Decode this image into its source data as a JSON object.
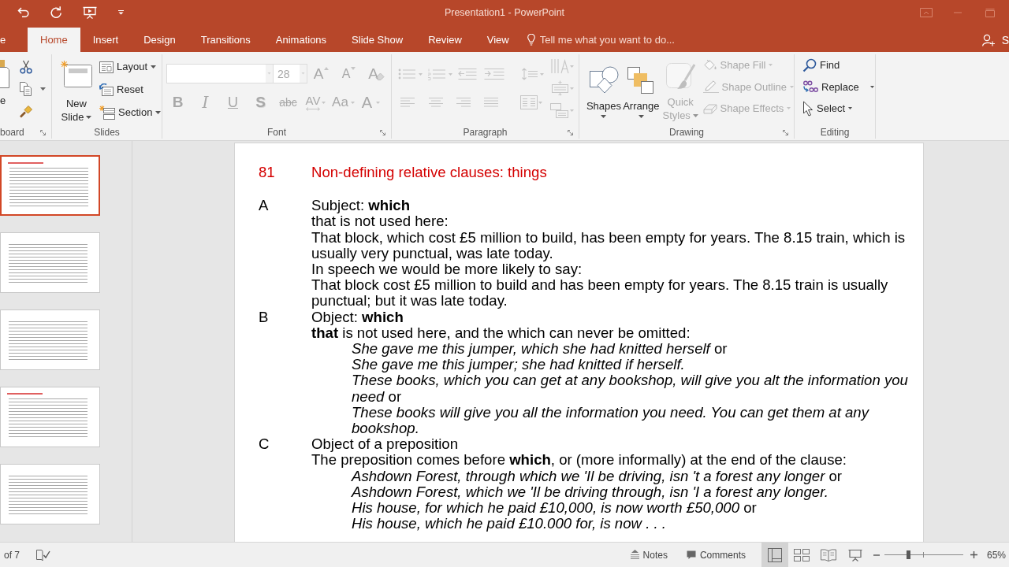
{
  "title_bar": {
    "title": "Presentation1 - PowerPoint"
  },
  "tabs": [
    {
      "label": "e",
      "selected": false
    },
    {
      "label": "Home",
      "selected": true
    },
    {
      "label": "Insert",
      "selected": false
    },
    {
      "label": "Design",
      "selected": false
    },
    {
      "label": "Transitions",
      "selected": false
    },
    {
      "label": "Animations",
      "selected": false
    },
    {
      "label": "Slide Show",
      "selected": false
    },
    {
      "label": "Review",
      "selected": false
    },
    {
      "label": "View",
      "selected": false
    }
  ],
  "tell_me": {
    "placeholder": "Tell me what you want to do..."
  },
  "account": {
    "label": "S"
  },
  "ribbon": {
    "groups": [
      {
        "label": "board",
        "controls": [
          {
            "label": "e",
            "disabled": false
          },
          {
            "disabled": false
          },
          {
            "disabled": false
          },
          {
            "disabled": false
          }
        ]
      },
      {
        "label": "Slides",
        "controls": [
          {
            "label": "New Slide",
            "disabled": false
          },
          {
            "label": "Layout",
            "disabled": false
          },
          {
            "label": "Reset",
            "disabled": false
          },
          {
            "label": "Section",
            "disabled": false
          }
        ]
      },
      {
        "label": "Font",
        "controls": [
          {
            "disabled": true
          },
          {
            "value": "28",
            "disabled": true
          },
          {
            "label": "A",
            "disabled": true
          },
          {
            "label": "A",
            "disabled": true
          },
          {
            "label": "A",
            "disabled": true
          },
          {
            "label": "B",
            "disabled": true
          },
          {
            "label": "I",
            "disabled": true
          },
          {
            "label": "U",
            "disabled": true
          },
          {
            "label": "S",
            "disabled": true
          },
          {
            "label": "abc",
            "disabled": true
          },
          {
            "label": "AV",
            "disabled": true
          },
          {
            "label": "Aa",
            "disabled": true
          },
          {
            "label": "A",
            "disabled": true
          }
        ]
      },
      {
        "label": "Paragraph",
        "controls": [
          {
            "disabled": true
          },
          {
            "disabled": true
          },
          {
            "disabled": true
          },
          {
            "disabled": true
          },
          {
            "disabled": true
          },
          {
            "disabled": true
          },
          {
            "disabled": true
          },
          {
            "disabled": true
          },
          {
            "disabled": true
          },
          {
            "disabled": true
          },
          {
            "disabled": true
          },
          {
            "disabled": true
          },
          {
            "disabled": true
          }
        ]
      },
      {
        "label": "Drawing",
        "controls": [
          {
            "label": "Shapes",
            "disabled": false
          },
          {
            "label": "Arrange",
            "disabled": false
          },
          {
            "label": "Quick Styles",
            "disabled": true
          },
          {
            "label": "Shape Fill",
            "disabled": true
          },
          {
            "label": "Shape Outline",
            "disabled": true
          },
          {
            "label": "Shape Effects",
            "disabled": true
          }
        ]
      },
      {
        "label": "Editing",
        "controls": [
          {
            "label": "Find",
            "disabled": false
          },
          {
            "label": "Replace",
            "disabled": false
          },
          {
            "label": "Select",
            "disabled": false
          }
        ]
      }
    ]
  },
  "thumbnails": [
    {
      "selected": true
    },
    {
      "selected": false
    },
    {
      "selected": false
    },
    {
      "selected": false
    },
    {
      "selected": false
    }
  ],
  "slide": {
    "number": "81",
    "title": "Non-defining relative clauses: things",
    "sections": [
      {
        "letter": "A",
        "lines": [
          {
            "kind": "text",
            "text": "Subject: **which**"
          },
          {
            "kind": "text",
            "text": "that is not used here:"
          },
          {
            "kind": "text",
            "text": "That block, which cost £5 million to build, has been empty for years. The 8.15 train, which is usually very punctual, was late today."
          },
          {
            "kind": "text",
            "text": "In speech we would be more likely to say:"
          },
          {
            "kind": "text",
            "text": "That block cost £5 million to build and has been empty for years. The 8.15 train is usually punctual; but it was late today."
          }
        ]
      },
      {
        "letter": "B",
        "lines": [
          {
            "kind": "text",
            "text": "Object: **which**"
          },
          {
            "kind": "text",
            "text": "**that** is not used here, and the which can never be omitted:"
          },
          {
            "kind": "pair",
            "text": "*She gave me this jumper, which she had knitted herself* or"
          },
          {
            "kind": "example",
            "text": "She gave me this jumper; she had knitted if herself."
          },
          {
            "kind": "pair",
            "text": "*These books, which you can get at any bookshop, will give you alt the information you need* or"
          },
          {
            "kind": "example",
            "text": "These books will give you all the information you need. You can get them at any bookshop."
          }
        ]
      },
      {
        "letter": "C",
        "lines": [
          {
            "kind": "text",
            "text": "Object of a preposition"
          },
          {
            "kind": "text",
            "text": "The preposition comes before **which**, or (more informally) at the end of the clause:"
          },
          {
            "kind": "pair",
            "text": "*Ashdown Forest, through which we 'Il be driving, isn 't a forest any longer* or"
          },
          {
            "kind": "example",
            "text": "Ashdown Forest, which we 'Il be driving through, isn 'I a forest any longer."
          },
          {
            "kind": "pair",
            "text": "*His house, for which he paid £10,000, is now worth £50,000* or"
          },
          {
            "kind": "example",
            "text": "His house, which he paid £10.000 for, is now . . ."
          }
        ]
      }
    ]
  },
  "status_bar": {
    "slide_count": "of 7",
    "notes": "Notes",
    "comments": "Comments",
    "views": [
      {
        "selected": true
      },
      {
        "selected": false
      },
      {
        "selected": false
      },
      {
        "selected": false
      }
    ],
    "zoom": {
      "level": 0.31,
      "reading": "65%"
    }
  }
}
